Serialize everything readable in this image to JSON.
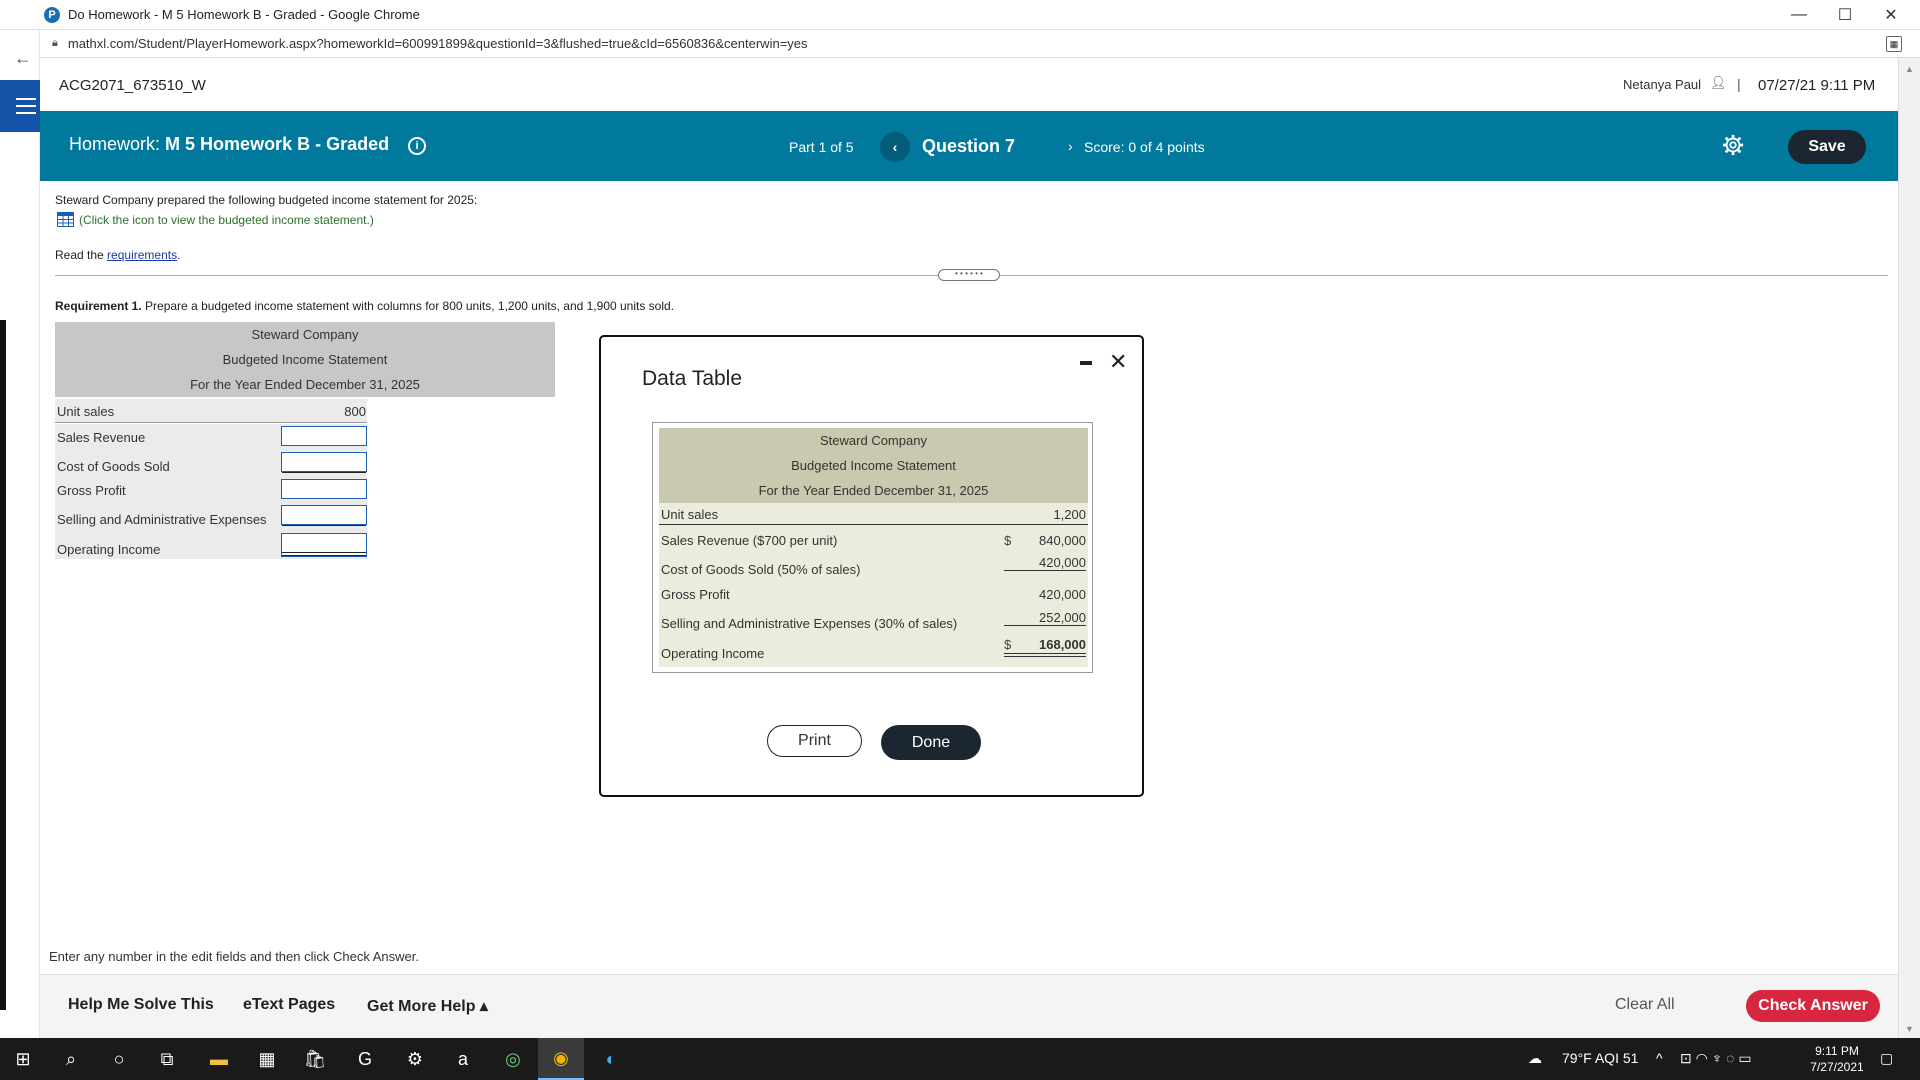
{
  "browser": {
    "window_title": "Do Homework - M 5 Homework B - Graded - Google Chrome",
    "app_icon_letter": "P",
    "url": "mathxl.com/Student/PlayerHomework.aspx?homeworkId=600991899&questionId=3&flushed=true&cId=6560836&centerwin=yes"
  },
  "header": {
    "course_id": "ACG2071_673510_W",
    "user_name": "Netanya Paul",
    "separator": "|",
    "datetime": "07/27/21 9:11 PM"
  },
  "homework_bar": {
    "label_prefix": "Homework:",
    "title": "M 5 Homework B - Graded",
    "part": "Part 1 of 5",
    "question": "Question 7",
    "score": "Score: 0 of 4 points",
    "save_label": "Save"
  },
  "question": {
    "intro": "Steward Company prepared the following budgeted income statement for 2025:",
    "table_link": "(Click the icon to view the budgeted income statement.)",
    "read_prefix": "Read the ",
    "requirements_link": "requirements",
    "read_suffix": ".",
    "req1_bold": "Requirement 1.",
    "req1_text": " Prepare a budgeted income statement with columns for 800 units, 1,200 units, and 1,900 units sold."
  },
  "answer_table": {
    "company": "Steward Company",
    "statement": "Budgeted Income Statement",
    "period": "For the Year Ended December 31, 2025",
    "unit_sales_label": "Unit sales",
    "unit_sales_value": "800",
    "rows": [
      "Sales Revenue",
      "Cost of Goods Sold",
      "Gross Profit",
      "Selling and Administrative Expenses",
      "Operating Income"
    ]
  },
  "modal": {
    "title": "Data Table",
    "company": "Steward Company",
    "statement": "Budgeted Income Statement",
    "period": "For the Year Ended December 31, 2025",
    "rows": [
      {
        "label": "Unit sales",
        "currency": "",
        "value": "1,200"
      },
      {
        "label": "Sales Revenue ($700 per unit)",
        "currency": "$",
        "value": "840,000"
      },
      {
        "label": "Cost of Goods Sold (50% of sales)",
        "currency": "",
        "value": "420,000"
      },
      {
        "label": "Gross Profit",
        "currency": "",
        "value": "420,000"
      },
      {
        "label": "Selling and Administrative Expenses (30% of sales)",
        "currency": "",
        "value": "252,000"
      },
      {
        "label": "Operating Income",
        "currency": "$",
        "value": "168,000"
      }
    ],
    "print_label": "Print",
    "done_label": "Done"
  },
  "footer": {
    "note": "Enter any number in the edit fields and then click Check Answer.",
    "help_me_solve": "Help Me Solve This",
    "etext": "eText Pages",
    "more_help": "Get More Help ▴",
    "clear_all": "Clear All",
    "check_answer": "Check Answer"
  },
  "taskbar": {
    "weather": "79°F  AQI 51",
    "time": "9:11 PM",
    "date": "7/27/2021"
  },
  "colors": {
    "header_teal": "#00799c",
    "save_dark": "#1b2631",
    "check_red": "#d7263d",
    "data_table_head": "#c9c9b0"
  }
}
